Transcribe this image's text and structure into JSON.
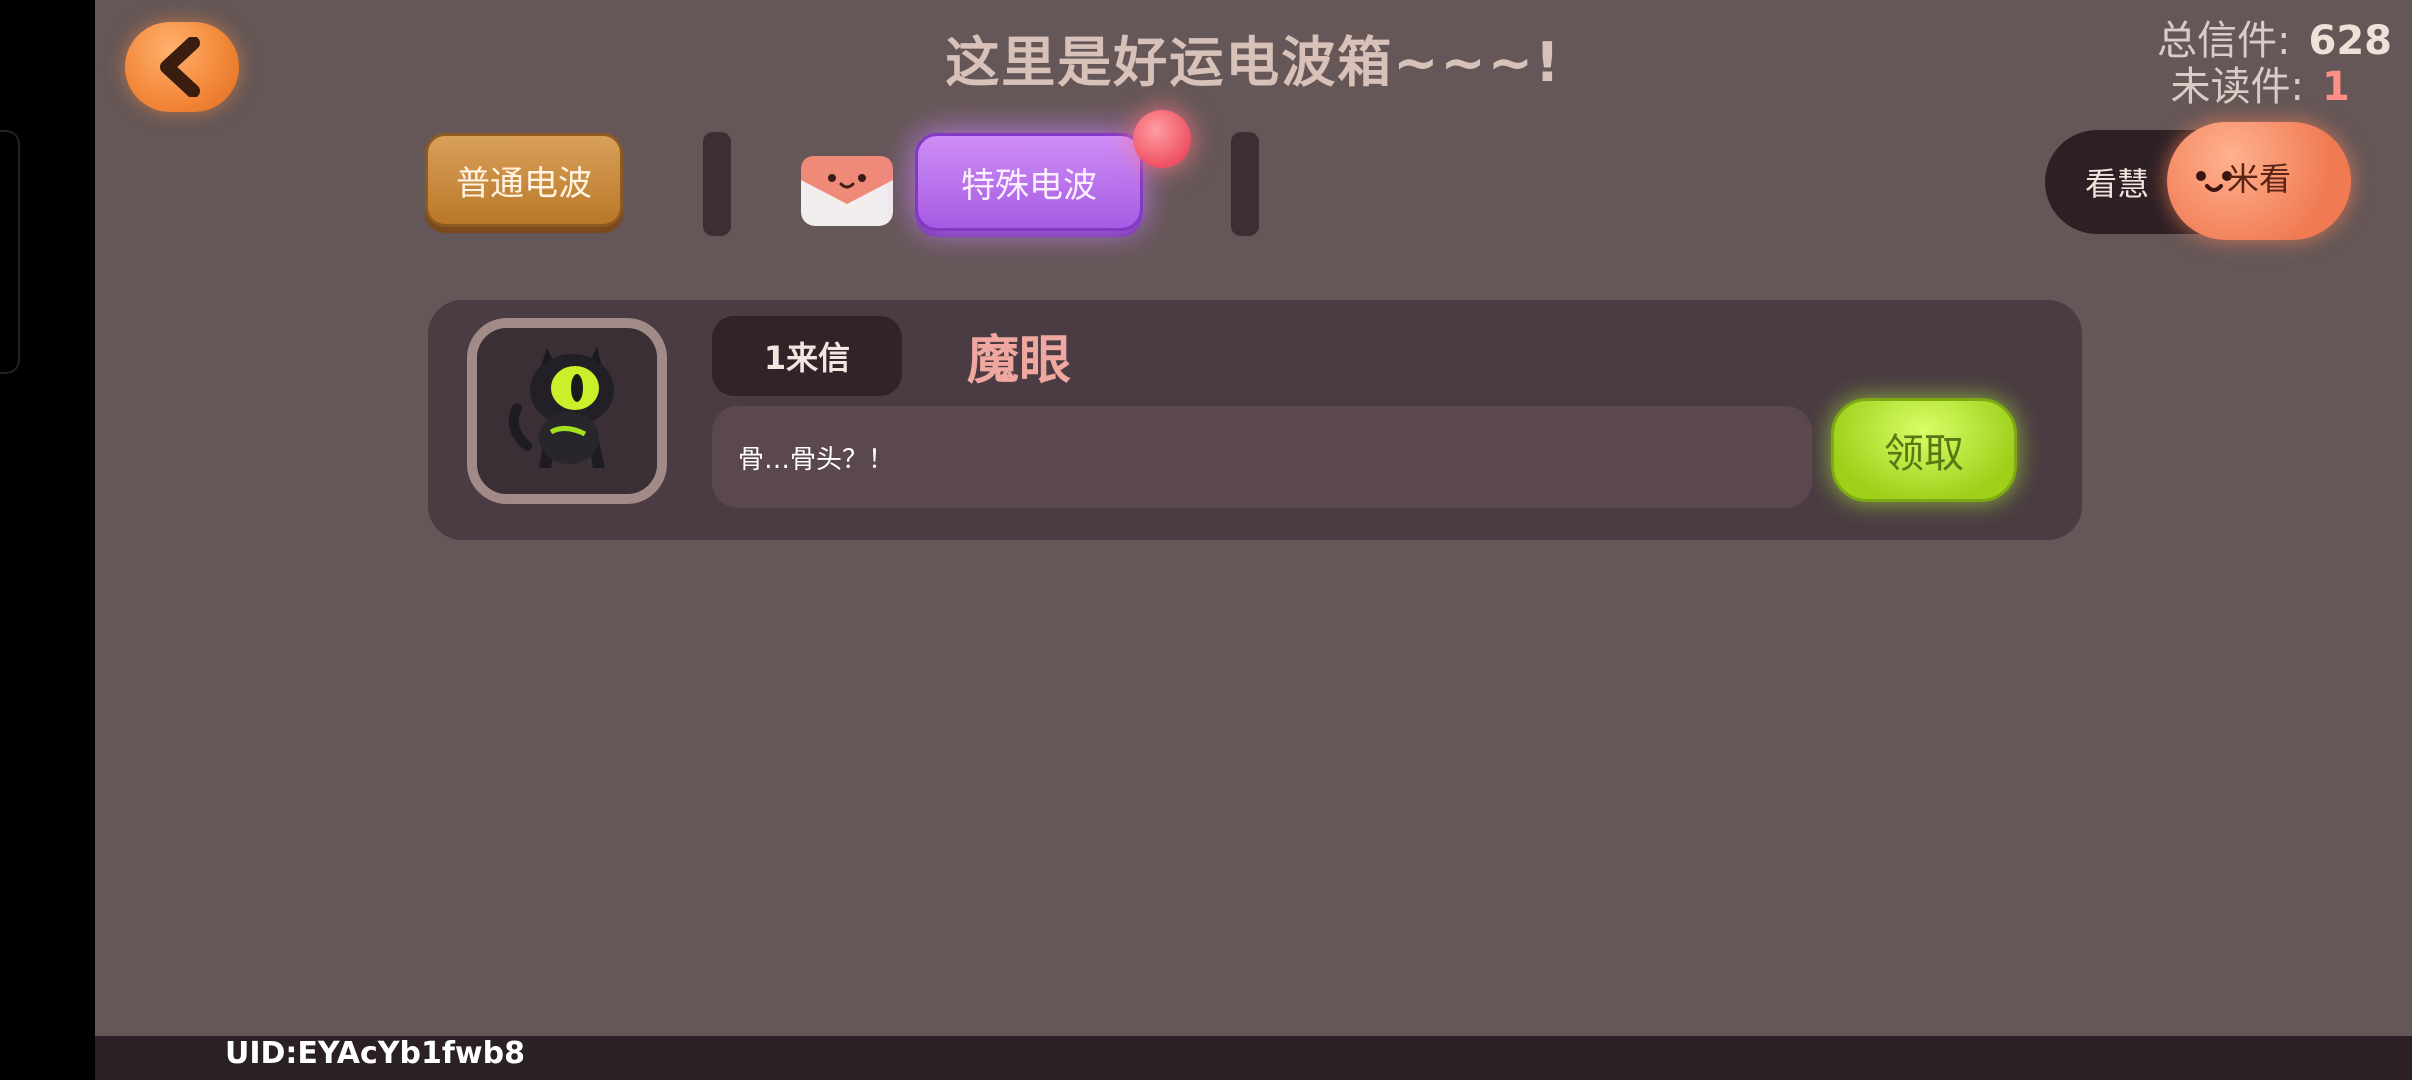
{
  "header": {
    "title": "这里是好运电波箱~~~!",
    "back_icon": "back-arrow-icon"
  },
  "stats": {
    "total_label": "总信件:",
    "total_value": "628",
    "unread_label": "未读件:",
    "unread_value": "1"
  },
  "tabs": {
    "normal_label": "普通电波",
    "special_label": "特殊电波",
    "mail_icon": "envelope-icon"
  },
  "ad": {
    "label_prefix": "看慧",
    "label_suffix": "米看"
  },
  "messages": [
    {
      "count_label": "1来信",
      "sender": "魔眼",
      "text": "骨…骨头？！",
      "claim_label": "领取",
      "avatar_icon": "cat-eye-creature-icon"
    }
  ],
  "footer": {
    "uid": "UID:EYAcYb1fwb8"
  },
  "colors": {
    "background": "#655757",
    "card": "#4a3c42",
    "accent_orange": "#f3893b",
    "accent_purple": "#a55be3",
    "accent_green": "#9ed01a"
  }
}
